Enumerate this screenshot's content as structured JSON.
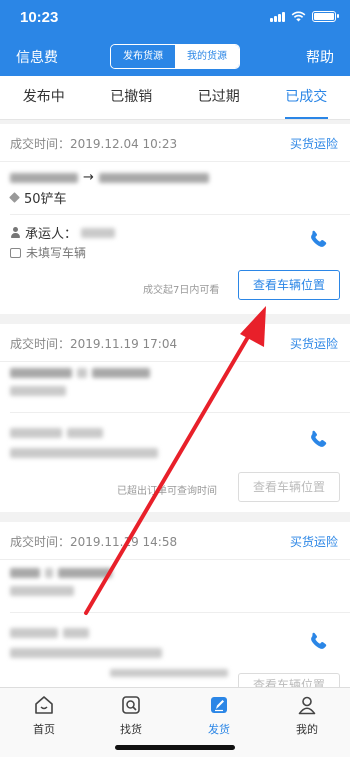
{
  "status_bar": {
    "time": "10:23"
  },
  "nav": {
    "left": "信息费",
    "segments": [
      "发布货源",
      "我的货源"
    ],
    "right": "帮助"
  },
  "tabs": [
    "发布中",
    "已撤销",
    "已过期",
    "已成交"
  ],
  "cards": [
    {
      "deal_time": "成交时间：2019.12.04 10:23",
      "buy_link": "买货运险",
      "cargo": "50铲车",
      "carrier_label": "承运人：",
      "vehicle": "未填写车辆",
      "hint": "成交起7日内可看",
      "button": "查看车辆位置"
    },
    {
      "deal_time": "成交时间：2019.11.19 17:04",
      "buy_link": "买货运险",
      "hint": "已超出订单可查询时间",
      "button": "查看车辆位置"
    },
    {
      "deal_time": "成交时间：2019.11.19 14:58",
      "buy_link": "买货运险",
      "button": "查看车辆位置"
    }
  ],
  "tabbar": [
    "首页",
    "找货",
    "发货",
    "我的"
  ],
  "colors": {
    "primary": "#2b86e6",
    "annotation": "#e8202a"
  },
  "icons": [
    "signal-icon",
    "wifi-icon",
    "battery-icon",
    "cube-icon",
    "person-icon",
    "truck-icon",
    "phone-icon",
    "home-icon",
    "search-goods-icon",
    "publish-icon",
    "user-icon"
  ]
}
